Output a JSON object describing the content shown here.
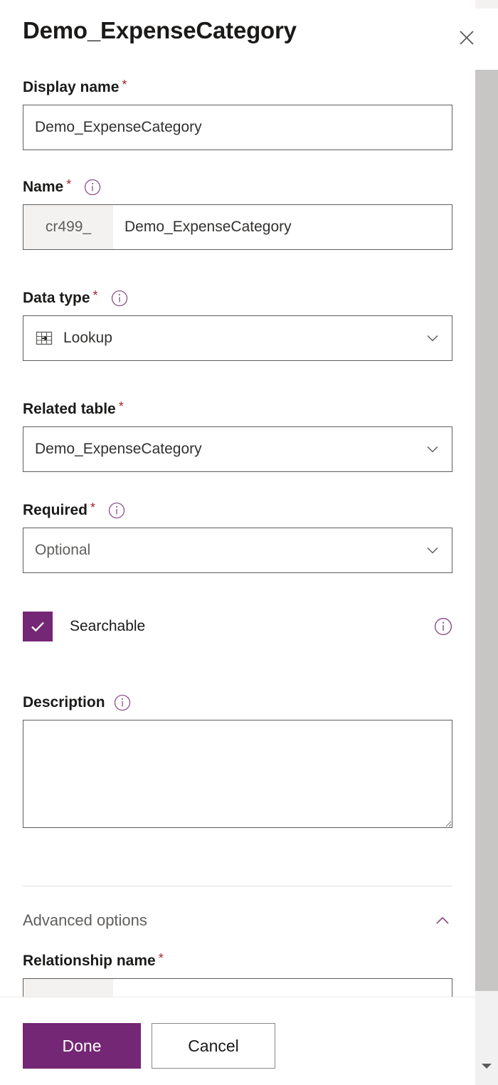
{
  "panel": {
    "title": "Demo_ExpenseCategory",
    "close_icon": "close-icon"
  },
  "fields": {
    "display_name": {
      "label": "Display name",
      "required_marker": "*",
      "value": "Demo_ExpenseCategory",
      "placeholder": ""
    },
    "name": {
      "label": "Name",
      "required_marker": "*",
      "prefix": "cr499_",
      "value": "Demo_ExpenseCategory",
      "info_icon": "info-icon"
    },
    "data_type": {
      "label": "Data type",
      "required_marker": "*",
      "value": "Lookup",
      "icon": "lookup-icon",
      "chevron": "chevron-down-icon",
      "info_icon": "info-icon"
    },
    "related_table": {
      "label": "Related table",
      "required_marker": "*",
      "value": "Demo_ExpenseCategory",
      "chevron": "chevron-down-icon"
    },
    "required": {
      "label": "Required",
      "required_marker": "*",
      "value": "Optional",
      "chevron": "chevron-down-icon",
      "info_icon": "info-icon"
    },
    "searchable": {
      "label": "Searchable",
      "checked": true,
      "check_icon": "checkmark-icon",
      "info_icon": "info-icon"
    },
    "description": {
      "label": "Description",
      "value": "",
      "placeholder": "",
      "info_icon": "info-icon"
    },
    "relationship_name": {
      "label": "Relationship name",
      "required_marker": "*",
      "prefix": "",
      "value": ""
    }
  },
  "advanced_options": {
    "label": "Advanced options",
    "expanded": true,
    "chevron": "chevron-up-icon"
  },
  "footer": {
    "done_label": "Done",
    "cancel_label": "Cancel"
  },
  "scrollbar": {
    "down_arrow_icon": "scroll-down-arrow-icon"
  },
  "colors": {
    "accent": "#742774",
    "required_star": "#a4262c",
    "border": "#605e5c",
    "prefix_bg": "#f3f2f1",
    "scroll_thumb": "#c8c6c4",
    "scroll_track": "#f1f1f1"
  }
}
